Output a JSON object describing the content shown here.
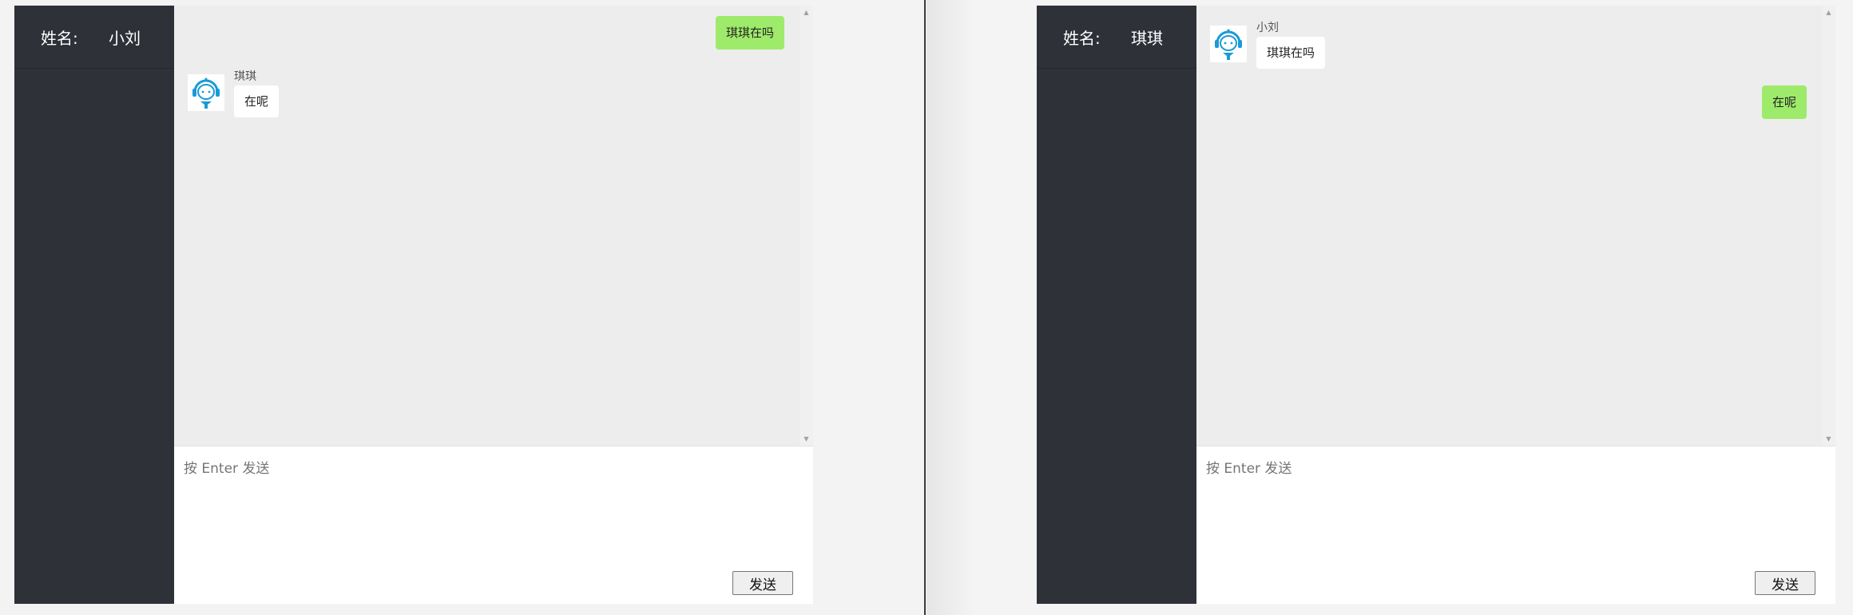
{
  "left": {
    "name_label": "姓名:",
    "user_name": "小刘",
    "outgoing_message": "琪琪在吗",
    "incoming_sender": "琪琪",
    "incoming_message": "在呢",
    "input_placeholder": "按 Enter 发送",
    "send_label": "发送"
  },
  "right": {
    "name_label": "姓名:",
    "user_name": "琪琪",
    "incoming_sender": "小刘",
    "incoming_message": "琪琪在吗",
    "outgoing_message": "在呢",
    "input_placeholder": "按 Enter 发送",
    "send_label": "发送"
  },
  "colors": {
    "sidebar": "#2e3138",
    "chat_background": "#ededed",
    "outgoing_bubble": "#9eea6a",
    "incoming_bubble": "#ffffff",
    "avatar_accent": "#1a9ad6"
  },
  "icons": {
    "avatar": "robot-headset-icon",
    "scroll_up": "triangle-up-icon",
    "scroll_down": "triangle-down-icon"
  }
}
